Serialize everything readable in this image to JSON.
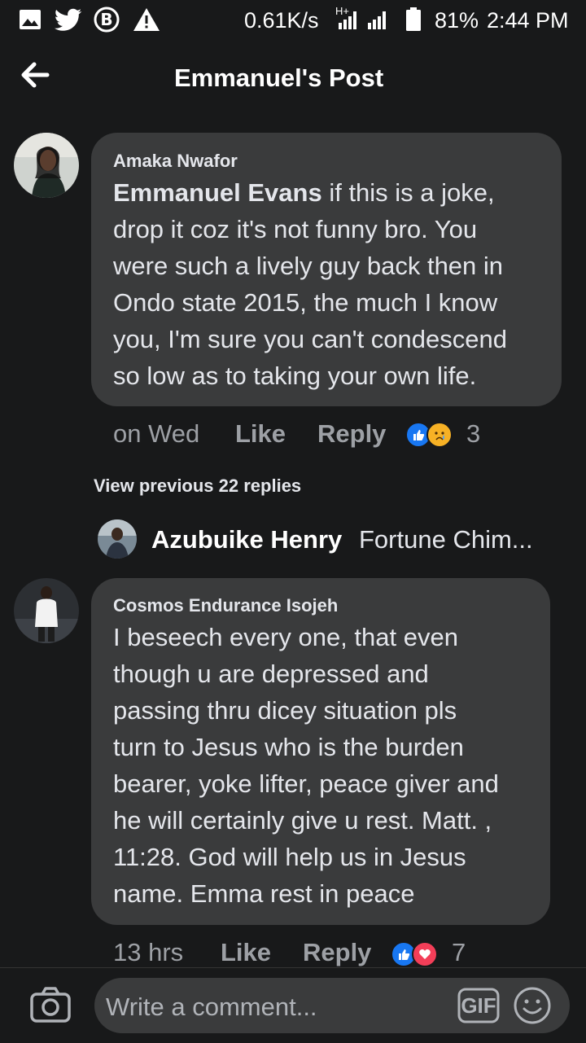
{
  "status_bar": {
    "network_speed": "0.61K/s",
    "network_type": "H+",
    "battery": "81%",
    "time": "2:44 PM",
    "icons": [
      "image-icon",
      "twitter-icon",
      "bitcoin-icon",
      "warning-icon",
      "signal-icon",
      "battery-icon"
    ]
  },
  "header": {
    "title": "Emmanuel's Post",
    "back_icon": "arrow-left-icon"
  },
  "comments": [
    {
      "author": "Amaka Nwafor",
      "mention": "Emmanuel Evans",
      "text_lines": [
        " if this is a joke,",
        "drop it coz it's not funny bro. You",
        "were such a lively guy back then in",
        "Ondo state 2015, the much I know",
        "you, I'm sure you can't condescend",
        "so low as to taking your own life."
      ],
      "time": "on Wed",
      "like_label": "Like",
      "reply_label": "Reply",
      "reactions": [
        "like",
        "sad"
      ],
      "reaction_count": "3"
    },
    {
      "author": "Cosmos Endurance Isojeh",
      "text_lines": [
        "I beseech every one, that even",
        "though u are  depressed and",
        "passing thru dicey  situation pls",
        "turn to Jesus who is the burden",
        "bearer, yoke lifter, peace giver and",
        "he will certainly give u rest. Matt. ,",
        "11:28. God will help us in Jesus",
        "name. Emma rest in peace"
      ],
      "time": "13 hrs",
      "like_label": "Like",
      "reply_label": "Reply",
      "reactions": [
        "like",
        "love"
      ],
      "reaction_count": "7"
    }
  ],
  "replies": {
    "view_previous": "View previous 22 replies",
    "latest_author": "Azubuike Henry",
    "latest_text": "Fortune Chim..."
  },
  "composer": {
    "placeholder": "Write a comment...",
    "gif_label": "GIF",
    "camera_icon": "camera-icon",
    "emoji_icon": "emoji-icon"
  },
  "colors": {
    "background": "#18191a",
    "bubble": "#3a3b3c",
    "like_blue": "#1877f2",
    "love_red": "#f33e58",
    "sad_yellow": "#f7b125"
  }
}
